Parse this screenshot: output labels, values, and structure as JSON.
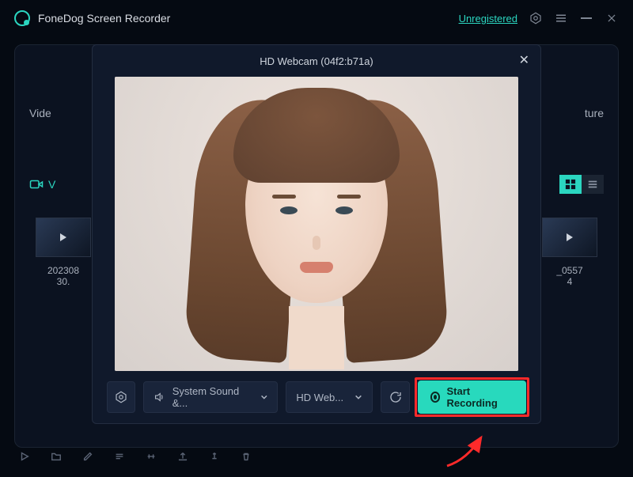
{
  "header": {
    "app_name": "FoneDog Screen Recorder",
    "unregistered_label": "Unregistered"
  },
  "background": {
    "left_mode": "Vide",
    "right_mode": "ture",
    "tab_left": "V",
    "thumb_left_name_line1": "202308",
    "thumb_left_name_line2": "30.",
    "thumb_right_name_line1": "_0557",
    "thumb_right_name_line2": "4"
  },
  "modal": {
    "title": "HD Webcam (04f2:b71a)",
    "audio_dropdown_label": "System Sound &...",
    "webcam_dropdown_label": "HD Web...",
    "start_button_label": "Start Recording"
  }
}
